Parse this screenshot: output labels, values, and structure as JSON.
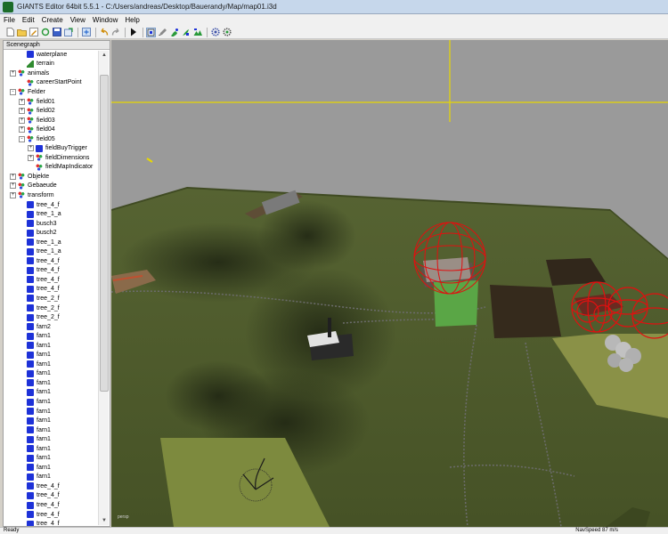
{
  "window": {
    "title": "GIANTS Editor 64bit 5.5.1 - C:/Users/andreas/Desktop/Bauerandy/Map/map01.i3d"
  },
  "menu": [
    "File",
    "Edit",
    "Create",
    "View",
    "Window",
    "Help"
  ],
  "toolbar": {
    "icons": [
      "new-file-icon",
      "open-folder-icon",
      "edit-icon",
      "refresh-icon",
      "save-icon",
      "export-icon",
      "import-icon",
      "undo-icon",
      "redo-icon",
      "play-icon",
      "select-tool-icon",
      "brush-tool-icon",
      "paint-tool-icon",
      "foliage-tool-icon",
      "terrain-tool-icon",
      "settings-icon",
      "grid-settings-icon"
    ]
  },
  "scenegraph": {
    "title": "Scenegraph",
    "nodes": [
      {
        "label": "waterplane",
        "icon": "cube",
        "level": 1,
        "exp": ""
      },
      {
        "label": "terrain",
        "icon": "terrain",
        "level": 1,
        "exp": ""
      },
      {
        "label": "animals",
        "icon": "transform",
        "level": 0,
        "exp": "+"
      },
      {
        "label": "careerStartPoint",
        "icon": "transform",
        "level": 1,
        "exp": ""
      },
      {
        "label": "Felder",
        "icon": "transform",
        "level": 0,
        "exp": "-"
      },
      {
        "label": "field01",
        "icon": "transform",
        "level": 1,
        "exp": "+"
      },
      {
        "label": "field02",
        "icon": "transform",
        "level": 1,
        "exp": "+"
      },
      {
        "label": "field03",
        "icon": "transform",
        "level": 1,
        "exp": "+"
      },
      {
        "label": "field04",
        "icon": "transform",
        "level": 1,
        "exp": "+"
      },
      {
        "label": "field05",
        "icon": "transform",
        "level": 1,
        "exp": "-"
      },
      {
        "label": "fieldBuyTrigger",
        "icon": "cube",
        "level": 2,
        "exp": "+"
      },
      {
        "label": "fieldDimensions",
        "icon": "transform",
        "level": 2,
        "exp": "+"
      },
      {
        "label": "fieldMapIndicator",
        "icon": "transform",
        "level": 2,
        "exp": ""
      },
      {
        "label": "Objekte",
        "icon": "transform",
        "level": 0,
        "exp": "+"
      },
      {
        "label": "Gebaeude",
        "icon": "transform",
        "level": 0,
        "exp": "+"
      },
      {
        "label": "transform",
        "icon": "transform",
        "level": 0,
        "exp": "+"
      },
      {
        "label": "tree_4_f",
        "icon": "cube",
        "level": 1,
        "exp": ""
      },
      {
        "label": "tree_1_a",
        "icon": "cube",
        "level": 1,
        "exp": ""
      },
      {
        "label": "busch3",
        "icon": "cube",
        "level": 1,
        "exp": ""
      },
      {
        "label": "busch2",
        "icon": "cube",
        "level": 1,
        "exp": ""
      },
      {
        "label": "tree_1_a",
        "icon": "cube",
        "level": 1,
        "exp": ""
      },
      {
        "label": "tree_1_a",
        "icon": "cube",
        "level": 1,
        "exp": ""
      },
      {
        "label": "tree_4_f",
        "icon": "cube",
        "level": 1,
        "exp": ""
      },
      {
        "label": "tree_4_f",
        "icon": "cube",
        "level": 1,
        "exp": ""
      },
      {
        "label": "tree_4_f",
        "icon": "cube",
        "level": 1,
        "exp": ""
      },
      {
        "label": "tree_4_f",
        "icon": "cube",
        "level": 1,
        "exp": ""
      },
      {
        "label": "tree_2_f",
        "icon": "cube",
        "level": 1,
        "exp": ""
      },
      {
        "label": "tree_2_f",
        "icon": "cube",
        "level": 1,
        "exp": ""
      },
      {
        "label": "tree_2_f",
        "icon": "cube",
        "level": 1,
        "exp": ""
      },
      {
        "label": "farn2",
        "icon": "cube",
        "level": 1,
        "exp": ""
      },
      {
        "label": "farn1",
        "icon": "cube",
        "level": 1,
        "exp": ""
      },
      {
        "label": "farn1",
        "icon": "cube",
        "level": 1,
        "exp": ""
      },
      {
        "label": "farn1",
        "icon": "cube",
        "level": 1,
        "exp": ""
      },
      {
        "label": "farn1",
        "icon": "cube",
        "level": 1,
        "exp": ""
      },
      {
        "label": "farn1",
        "icon": "cube",
        "level": 1,
        "exp": ""
      },
      {
        "label": "farn1",
        "icon": "cube",
        "level": 1,
        "exp": ""
      },
      {
        "label": "farn1",
        "icon": "cube",
        "level": 1,
        "exp": ""
      },
      {
        "label": "farn1",
        "icon": "cube",
        "level": 1,
        "exp": ""
      },
      {
        "label": "farn1",
        "icon": "cube",
        "level": 1,
        "exp": ""
      },
      {
        "label": "farn1",
        "icon": "cube",
        "level": 1,
        "exp": ""
      },
      {
        "label": "farn1",
        "icon": "cube",
        "level": 1,
        "exp": ""
      },
      {
        "label": "farn1",
        "icon": "cube",
        "level": 1,
        "exp": ""
      },
      {
        "label": "farn1",
        "icon": "cube",
        "level": 1,
        "exp": ""
      },
      {
        "label": "farn1",
        "icon": "cube",
        "level": 1,
        "exp": ""
      },
      {
        "label": "farn1",
        "icon": "cube",
        "level": 1,
        "exp": ""
      },
      {
        "label": "farn1",
        "icon": "cube",
        "level": 1,
        "exp": ""
      },
      {
        "label": "tree_4_f",
        "icon": "cube",
        "level": 1,
        "exp": ""
      },
      {
        "label": "tree_4_f",
        "icon": "cube",
        "level": 1,
        "exp": ""
      },
      {
        "label": "tree_4_f",
        "icon": "cube",
        "level": 1,
        "exp": ""
      },
      {
        "label": "tree_4_f",
        "icon": "cube",
        "level": 1,
        "exp": ""
      },
      {
        "label": "tree_4_f",
        "icon": "cube",
        "level": 1,
        "exp": ""
      }
    ]
  },
  "viewport": {
    "camera_label": "persp"
  },
  "status": {
    "left": "Ready",
    "right": "NavSpeed 87 m/s"
  },
  "colors": {
    "sky": "#9a9a9a",
    "grass": "#4e5c2b",
    "field_dirt": "#352a1c",
    "selection_red": "#e01010",
    "axis_yellow": "#e8d800",
    "cube_blue": "#1e32d8"
  }
}
